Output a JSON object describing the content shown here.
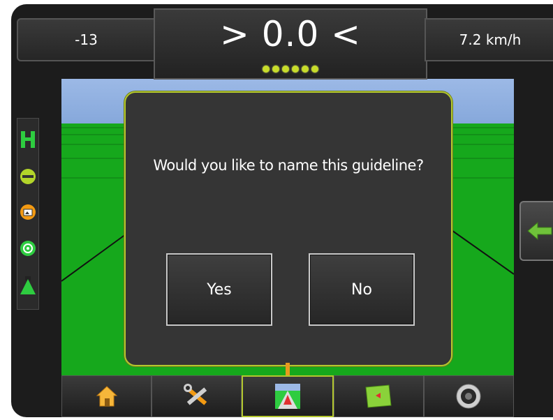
{
  "header": {
    "left_value": "-13",
    "center_value": "> 0.0 <",
    "right_value": "7.2 km/h",
    "lightbar_dot_count": 6
  },
  "dialog": {
    "question": "Would you like to name this guideline?",
    "yes_label": "Yes",
    "no_label": "No"
  },
  "left_toolbar": {
    "icons": [
      "guidance-mode-icon",
      "straight-ab-line-icon",
      "camera-icon",
      "steering-wheel-icon",
      "vehicle-view-icon"
    ]
  },
  "right_tab": {
    "icon": "back-arrow-icon"
  },
  "tabs": {
    "items": [
      "home-icon",
      "tools-icon",
      "guidance-view-icon",
      "field-map-icon",
      "camera-lens-icon"
    ],
    "active": "guidance-view-icon"
  },
  "colors": {
    "accent": "#b3c72e",
    "field_green": "#16a81c",
    "sky": "#9cb9e6",
    "panel": "#353535",
    "connector": "#e89a1e"
  }
}
